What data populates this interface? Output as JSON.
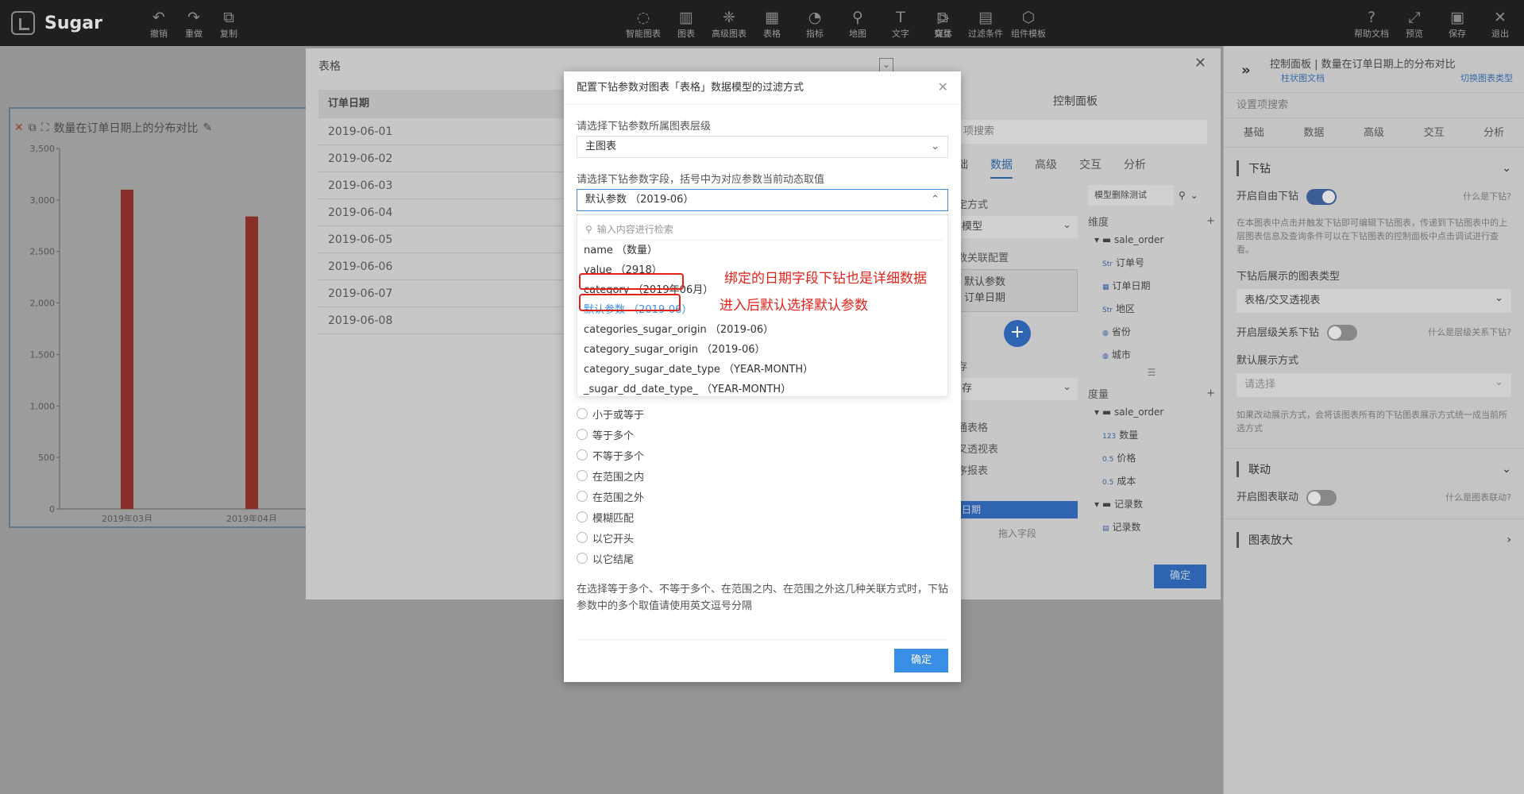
{
  "app": {
    "name": "Sugar"
  },
  "toolbar_left": [
    {
      "icon": "↶",
      "label": "撤销"
    },
    {
      "icon": "↷",
      "label": "重做"
    },
    {
      "icon": "⧉",
      "label": "复制"
    }
  ],
  "toolbar_center": [
    {
      "icon": "◌",
      "label": "智能图表"
    },
    {
      "icon": "▥",
      "label": "图表"
    },
    {
      "icon": "❈",
      "label": "高级图表"
    },
    {
      "icon": "▦",
      "label": "表格"
    },
    {
      "icon": "◔",
      "label": "指标"
    },
    {
      "icon": "⚲",
      "label": "地图"
    },
    {
      "icon": "T",
      "label": "文字"
    },
    {
      "icon": "▷",
      "label": "媒体"
    }
  ],
  "toolbar_center2": [
    {
      "icon": "⧉",
      "label": "交互"
    },
    {
      "icon": "▤",
      "label": "过滤条件"
    },
    {
      "icon": "⬡",
      "label": "组件模板"
    }
  ],
  "toolbar_right": [
    {
      "icon": "?",
      "label": "帮助文档"
    },
    {
      "icon": "⤢",
      "label": "预览"
    },
    {
      "icon": "▣",
      "label": "保存"
    },
    {
      "icon": "✕",
      "label": "退出"
    }
  ],
  "bg_chart": {
    "title": "数量在订单日期上的分布对比",
    "edit_icon": "✎"
  },
  "chart_data": {
    "type": "bar",
    "categories": [
      "2019年03月",
      "2019年04月"
    ],
    "series": [
      {
        "values": [
          3100,
          2840
        ]
      }
    ],
    "ylim": [
      0,
      3500
    ],
    "yticks": [
      "0",
      "500",
      "1,000",
      "1,500",
      "2,000",
      "2,500",
      "3,000",
      "3,500"
    ],
    "bar_color": "#a31a12"
  },
  "table_modal": {
    "title": "表格",
    "collapse": "⌄",
    "close": "✕",
    "column": "订单日期",
    "rows": [
      "2019-06-01",
      "2019-06-02",
      "2019-06-03",
      "2019-06-04",
      "2019-06-05",
      "2019-06-06",
      "2019-06-07",
      "2019-06-08"
    ],
    "panel_title": "控制面板",
    "search": "项搜索",
    "tabs": [
      "础",
      "数据",
      "高级",
      "交互",
      "分析"
    ],
    "filter_label": "定方式",
    "filter_value": "模型",
    "relation_label": "数关联配置",
    "relation_box": [
      "默认参数",
      "订单日期"
    ],
    "cache_label": "存",
    "cache_value": "存",
    "view_items": [
      "通表格",
      "叉透视表",
      "序报表"
    ],
    "date_field": "日期",
    "drag_hint": "拖入字段",
    "model_select": "模型删除测试",
    "dimension_label": "维度",
    "dimension_group": "sale_order",
    "dimensions": [
      {
        "tag": "Str",
        "name": "订单号"
      },
      {
        "tag": "▦",
        "name": "订单日期"
      },
      {
        "tag": "Str",
        "name": "地区"
      },
      {
        "tag": "◍",
        "name": "省份"
      },
      {
        "tag": "◍",
        "name": "城市"
      }
    ],
    "measure_label": "度量",
    "measure_group": "sale_order",
    "measures": [
      {
        "tag": "123",
        "name": "数量"
      },
      {
        "tag": "0.5",
        "name": "价格"
      },
      {
        "tag": "0.5",
        "name": "成本"
      }
    ],
    "record_group": "记录数",
    "records": [
      {
        "tag": "▤",
        "name": "记录数"
      }
    ],
    "ok": "确定"
  },
  "right_panel": {
    "title": "控制面板 | 数量在订单日期上的分布对比",
    "sub": "柱状图文档",
    "switch": "切换图表类型",
    "search": "设置项搜索",
    "tabs": [
      "基础",
      "数据",
      "高级",
      "交互",
      "分析"
    ],
    "drill_section": "下钻",
    "free_drill": "开启自由下钻",
    "free_drill_help": "什么是下钻?",
    "drill_desc": "在本图表中点击并触发下钻即可编辑下钻图表，传递到下钻图表中的上层图表信息及查询条件可以在下钻图表的控制面板中点击调试进行查看。",
    "drill_type_label": "下钻后展示的图表类型",
    "drill_type_value": "表格/交叉透视表",
    "level_drill": "开启层级关系下钻",
    "level_drill_help": "什么是层级关系下钻?",
    "show_mode_label": "默认展示方式",
    "show_mode_placeholder": "请选择",
    "show_mode_desc": "如果改动展示方式，会将该图表所有的下钻图表展示方式统一成当前所选方式",
    "link_section": "联动",
    "link_toggle": "开启图表联动",
    "link_help": "什么是图表联动?",
    "zoom_section": "图表放大"
  },
  "dialog": {
    "title": "配置下钻参数对图表「表格」数据模型的过滤方式",
    "close": "✕",
    "level_label": "请选择下钻参数所属图表层级",
    "level_value": "主图表",
    "field_label": "请选择下钻参数字段，括号中为对应参数当前动态取值",
    "field_value": "默认参数 （2019-06）",
    "search_placeholder": "输入内容进行检索",
    "options": [
      "name （数量）",
      "value （2918）",
      "category （2019年06月）",
      "默认参数 （2019-06）",
      "categories_sugar_origin （2019-06）",
      "category_sugar_origin （2019-06）",
      "category_sugar_date_type （YEAR-MONTH）",
      "_sugar_dd_date_type_ （YEAR-MONTH）"
    ],
    "annotation1": "绑定的日期字段下钻也是详细数据",
    "annotation2": "进入后默认选择默认参数",
    "radios": [
      "小于或等于",
      "等于多个",
      "不等于多个",
      "在范围之内",
      "在范围之外",
      "模糊匹配",
      "以它开头",
      "以它结尾"
    ],
    "note": "在选择等于多个、不等于多个、在范围之内、在范围之外这几种关联方式时，下钻参数中的多个取值请使用英文逗号分隔",
    "ok": "确定"
  }
}
